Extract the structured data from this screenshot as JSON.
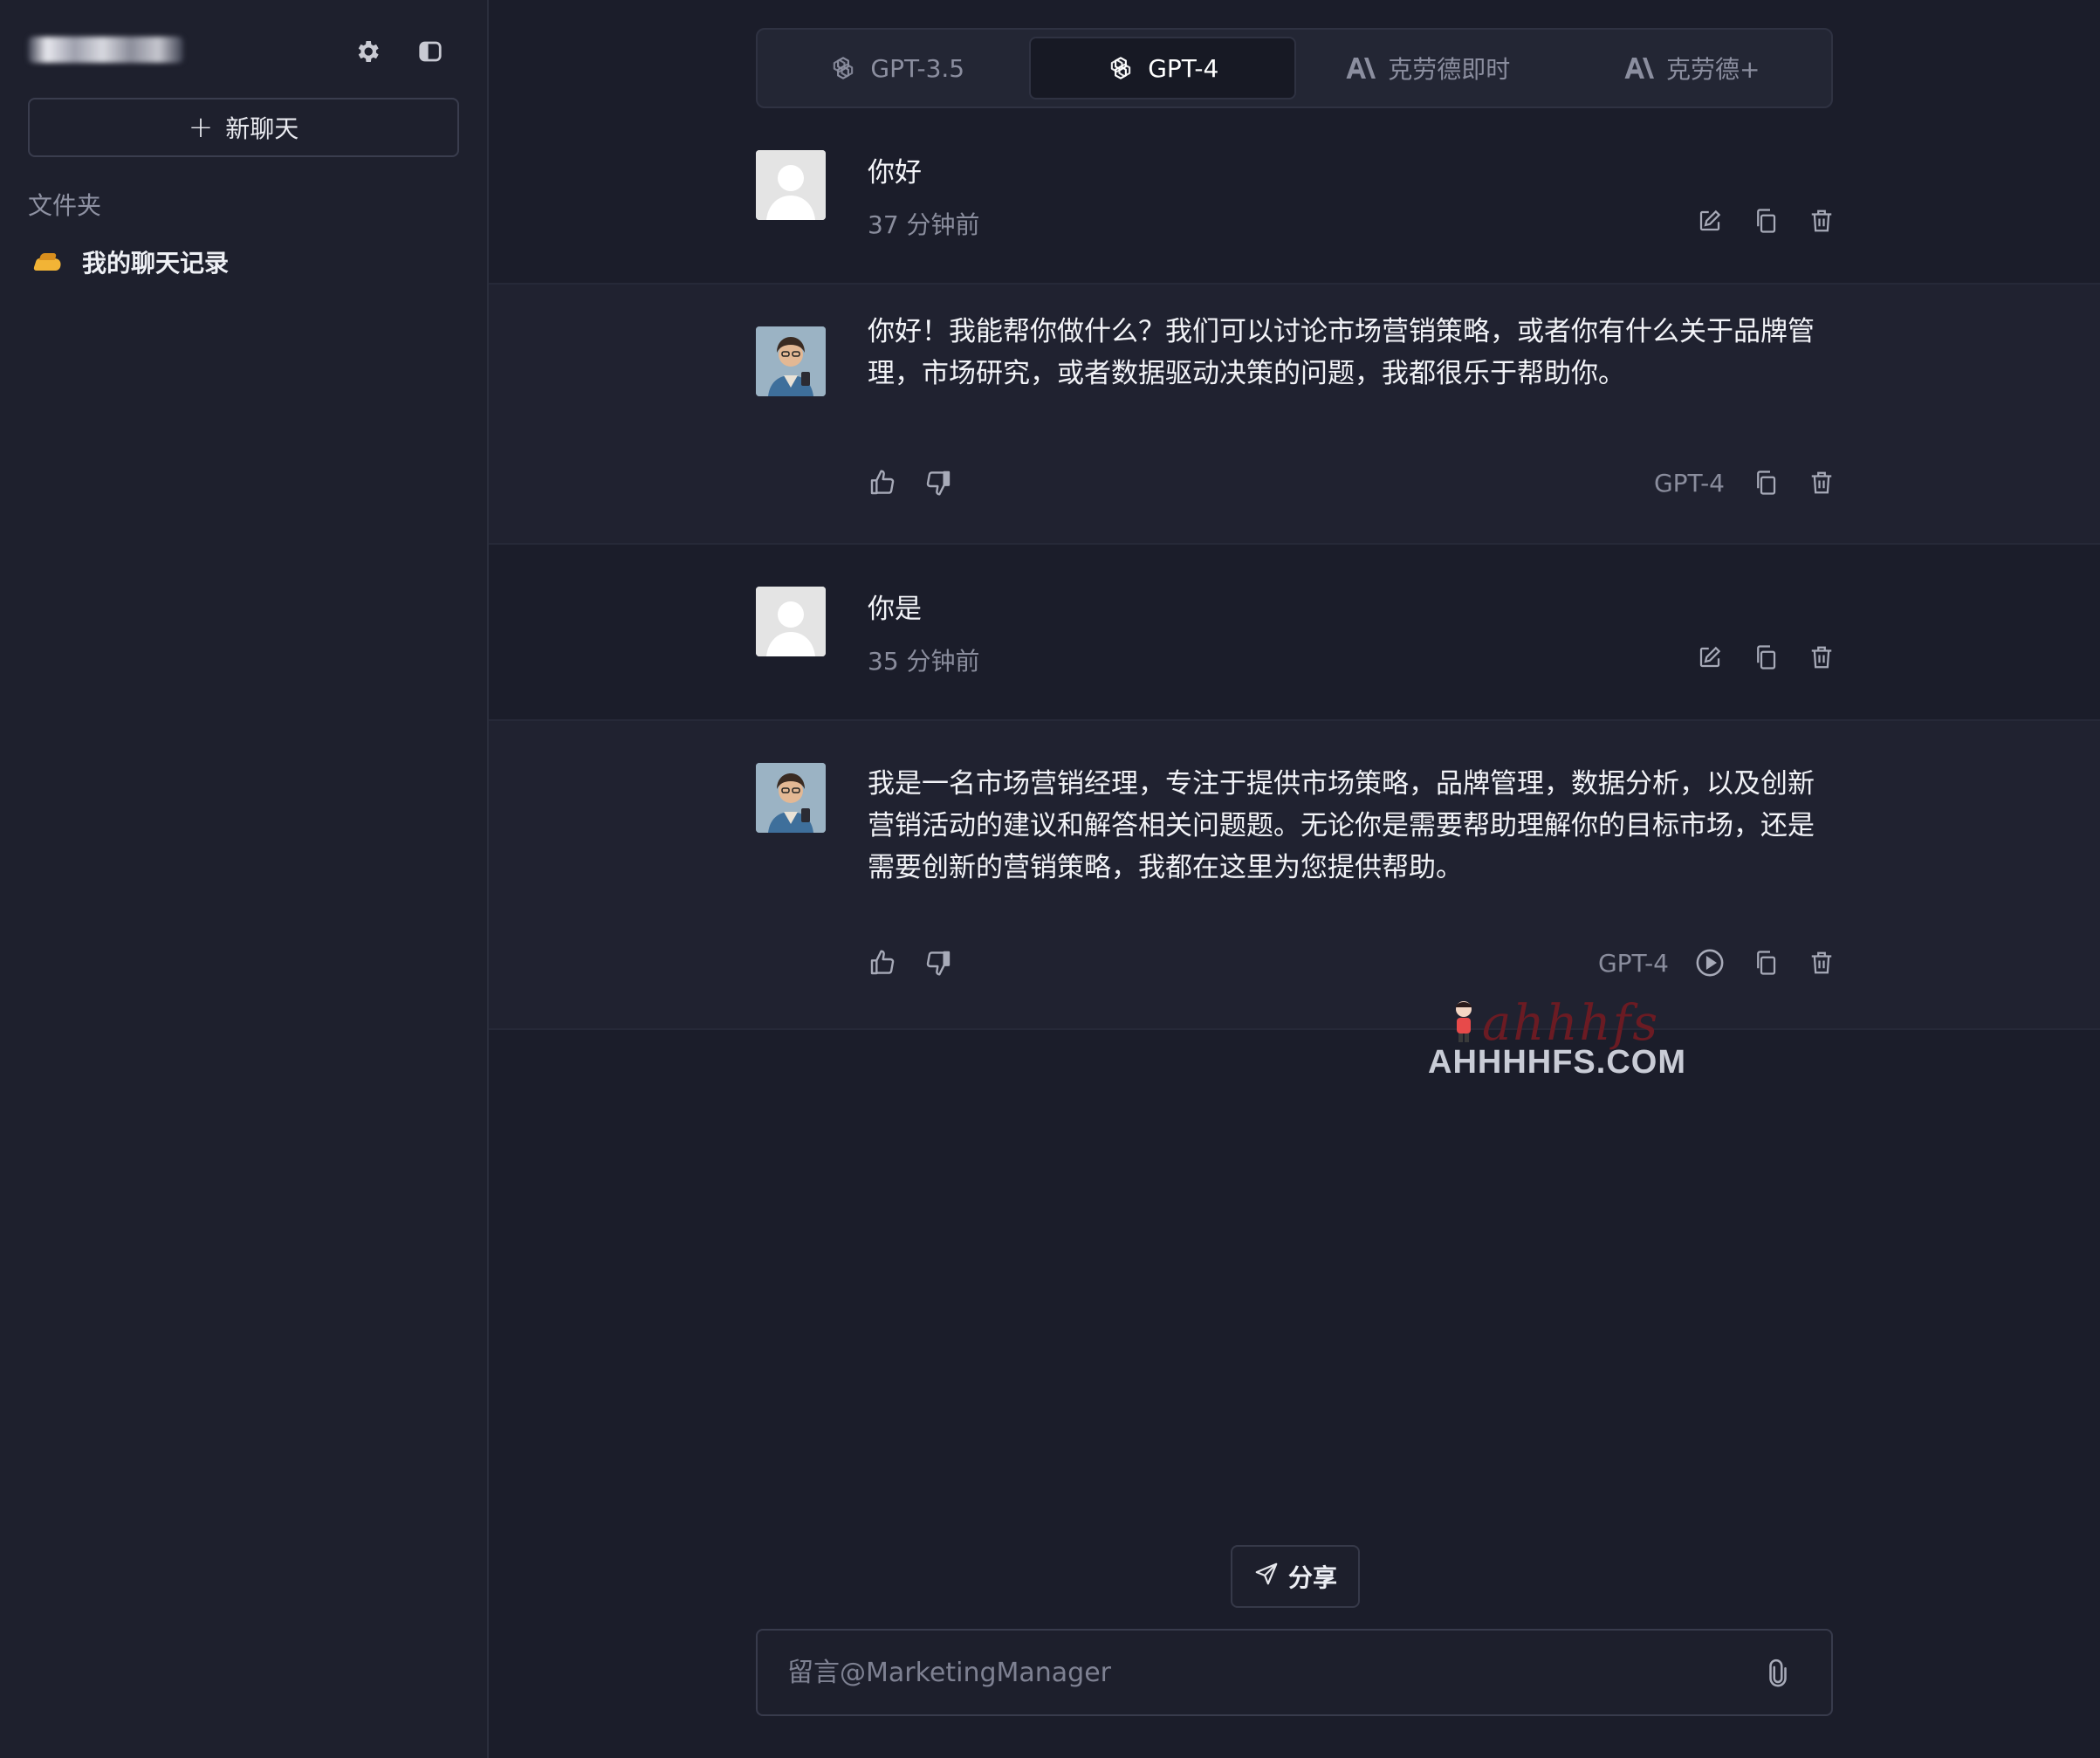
{
  "sidebar": {
    "new_chat_label": "新聊天",
    "folder_heading": "文件夹",
    "folders": [
      {
        "label": "我的聊天记录"
      }
    ]
  },
  "model_tabs": [
    {
      "label": "GPT-3.5",
      "icon": "openai-icon",
      "active": false
    },
    {
      "label": "GPT-4",
      "icon": "openai-icon",
      "active": true
    },
    {
      "label": "克劳德即时",
      "icon": "anthropic-icon",
      "active": false
    },
    {
      "label": "克劳德+",
      "icon": "anthropic-icon",
      "active": false
    }
  ],
  "messages": [
    {
      "role": "user",
      "text": "你好",
      "time": "37 分钟前"
    },
    {
      "role": "assistant",
      "text": "你好！我能帮你做什么？我们可以讨论市场营销策略，或者你有什么关于品牌管理，市场研究，或者数据驱动决策的问题，我都很乐于帮助你。",
      "model": "GPT-4"
    },
    {
      "role": "user",
      "text": "你是",
      "time": "35 分钟前"
    },
    {
      "role": "assistant",
      "text": "我是一名市场营销经理，专注于提供市场策略，品牌管理，数据分析，以及创新营销活动的建议和解答相关问题题。无论你是需要帮助理解你的目标市场，还是需要创新的营销策略，我都在这里为您提供帮助。",
      "model": "GPT-4"
    }
  ],
  "watermark": {
    "script": "ahhhfs",
    "url": "AHHHHFS.COM"
  },
  "share_label": "分享",
  "composer": {
    "placeholder": "留言@MarketingManager",
    "value": ""
  },
  "colors": {
    "background": "#1b1d2a",
    "sidebar": "#1e202d",
    "assistant_row": "#202230",
    "active_tab": "#171924"
  }
}
